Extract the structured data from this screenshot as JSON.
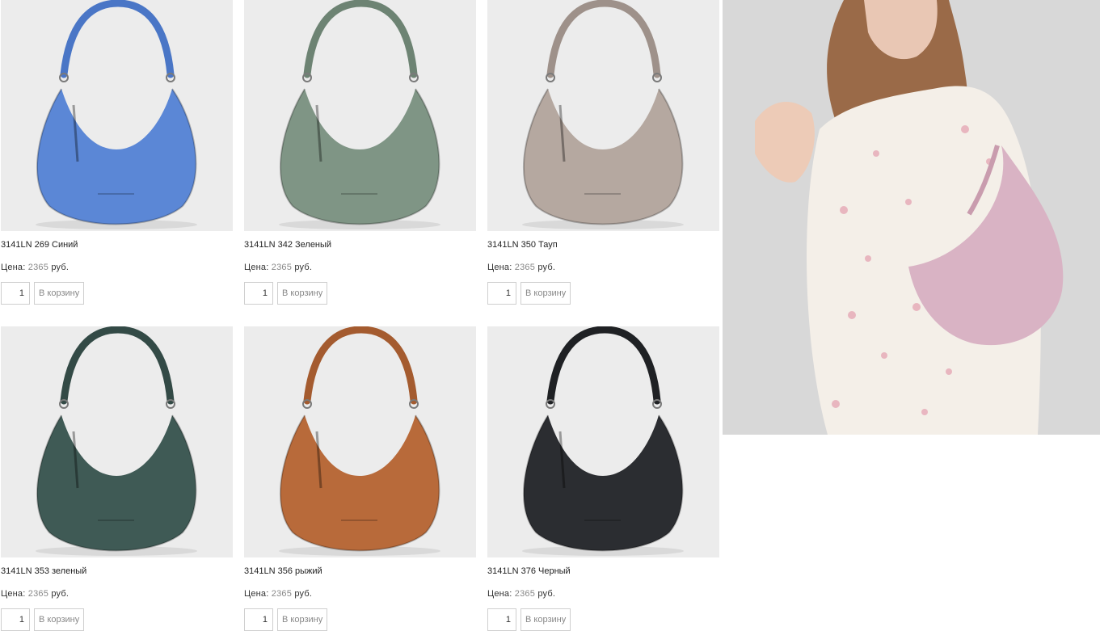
{
  "products": [
    {
      "name": "3141LN 269 Синий",
      "price_label": "Цена:",
      "price": "2365",
      "currency": "руб.",
      "qty": "1",
      "cart_label": "В корзину",
      "color": "#5b87d6",
      "strap": "#4a76c6"
    },
    {
      "name": "3141LN 342 Зеленый",
      "price_label": "Цена:",
      "price": "2365",
      "currency": "руб.",
      "qty": "1",
      "cart_label": "В корзину",
      "color": "#7f9585",
      "strap": "#6d8373"
    },
    {
      "name": "3141LN 350 Тауп",
      "price_label": "Цена:",
      "price": "2365",
      "currency": "руб.",
      "qty": "1",
      "cart_label": "В корзину",
      "color": "#b5a8a0",
      "strap": "#9e918a"
    },
    {
      "name": "3141LN 353 зеленый",
      "price_label": "Цена:",
      "price": "2365",
      "currency": "руб.",
      "qty": "1",
      "cart_label": "В корзину",
      "color": "#3f5a55",
      "strap": "#334a46"
    },
    {
      "name": "3141LN 356 рыжий",
      "price_label": "Цена:",
      "price": "2365",
      "currency": "руб.",
      "qty": "1",
      "cart_label": "В корзину",
      "color": "#b86a3a",
      "strap": "#a45b2f"
    },
    {
      "name": "3141LN 376 Черный",
      "price_label": "Цена:",
      "price": "2365",
      "currency": "руб.",
      "qty": "1",
      "cart_label": "В корзину",
      "color": "#2b2d31",
      "strap": "#1f2124"
    }
  ],
  "banner": {
    "bag_color": "#d9b3c4",
    "dress_color": "#f4efe8"
  }
}
